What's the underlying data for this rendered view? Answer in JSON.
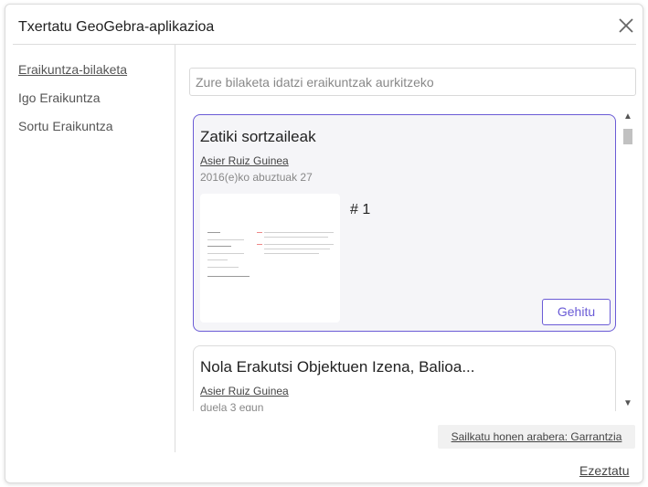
{
  "dialog": {
    "title": "Txertatu GeoGebra-aplikazioa",
    "close_icon": "close-icon"
  },
  "sidebar": {
    "items": [
      {
        "label": "Eraikuntza-bilaketa",
        "active": true
      },
      {
        "label": "Igo Eraikuntza",
        "active": false
      },
      {
        "label": "Sortu Eraikuntza",
        "active": false
      }
    ]
  },
  "search": {
    "placeholder": "Zure bilaketa idatzi eraikuntzak aurkitzeko",
    "value": ""
  },
  "results": [
    {
      "title": "Zatiki sortzaileak",
      "author": "Asier Ruiz Guinea",
      "date": "2016(e)ko abuztuak 27",
      "page": "# 1",
      "add_label": "Gehitu",
      "selected": true
    },
    {
      "title": "Nola Erakutsi Objektuen Izena, Balioa...",
      "author": "Asier Ruiz Guinea",
      "date": "duela 3 egun",
      "selected": false
    }
  ],
  "scrollbar": {
    "up_glyph": "▲",
    "down_glyph": "▼"
  },
  "sort": {
    "label": "Sailkatu honen arabera: Garrantzia"
  },
  "footer": {
    "cancel_label": "Ezeztatu"
  },
  "colors": {
    "accent": "#6a5bd6",
    "border": "#dcdcdc",
    "selected_bg": "#f5f5f8"
  }
}
